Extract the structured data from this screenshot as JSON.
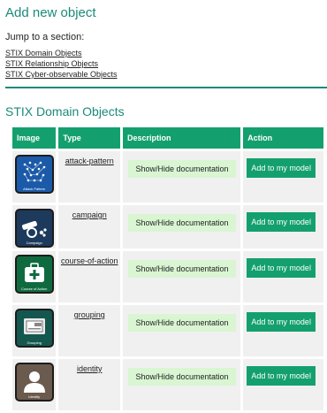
{
  "header": {
    "title": "Add new object"
  },
  "jump": {
    "label": "Jump to a section:",
    "links": [
      "STIX Domain Objects",
      "STIX Relationship Objects",
      "STIX Cyber-observable Objects"
    ]
  },
  "section": {
    "title": "STIX Domain Objects"
  },
  "table": {
    "columns": [
      "Image",
      "Type",
      "Description",
      "Action"
    ],
    "rows": [
      {
        "type": "attack-pattern",
        "icon": "attack-pattern-icon",
        "caption": "Attack Pattern",
        "doc": "Show/Hide documentation",
        "action": "Add to my model"
      },
      {
        "type": "campaign",
        "icon": "campaign-icon",
        "caption": "Campaign",
        "doc": "Show/Hide documentation",
        "action": "Add to my model"
      },
      {
        "type": "course-of-action",
        "icon": "course-of-action-icon",
        "caption": "Course of Action",
        "doc": "Show/Hide documentation",
        "action": "Add to my model"
      },
      {
        "type": "grouping",
        "icon": "grouping-icon",
        "caption": "Grouping",
        "doc": "Show/Hide documentation",
        "action": "Add to my model"
      },
      {
        "type": "identity",
        "icon": "identity-icon",
        "caption": "Identity",
        "doc": "Show/Hide documentation",
        "action": "Add to my model"
      }
    ]
  },
  "colors": {
    "accent": "#1a8a7a",
    "header_bg": "#14a06e",
    "doc_button_bg": "#d9f5d2",
    "cell_bg": "#f0f0f0"
  }
}
